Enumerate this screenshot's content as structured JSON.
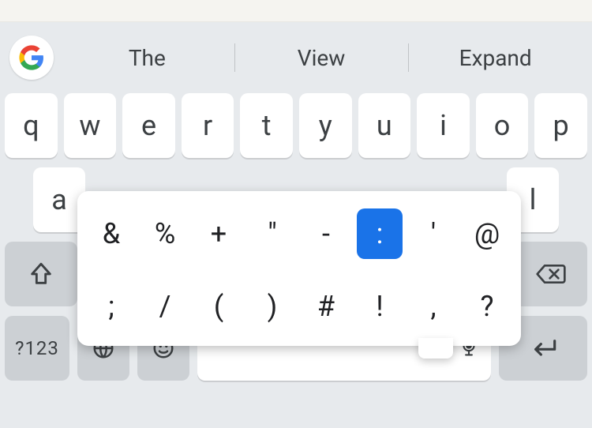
{
  "suggestions": [
    "The",
    "View",
    "Expand"
  ],
  "rows": {
    "top": [
      "q",
      "w",
      "e",
      "r",
      "t",
      "y",
      "u",
      "i",
      "o",
      "p"
    ],
    "mid_first": "a",
    "mid_last": "l",
    "numkey": "?123"
  },
  "popup": {
    "row1": [
      "&",
      "%",
      "+",
      "\"",
      "-",
      ":",
      "'",
      "@"
    ],
    "row2": [
      ";",
      "/",
      "(",
      ")",
      "#",
      "!",
      ",",
      "?"
    ],
    "selected": ":"
  },
  "icons": {
    "shift": "shift",
    "backspace": "backspace",
    "globe": "globe",
    "emoji": "emoji",
    "mic": "mic",
    "enter": "enter",
    "google": "G"
  },
  "colors": {
    "accent": "#1a73e8",
    "key_bg": "#ffffff",
    "fn_bg": "#ccd0d4",
    "kb_bg": "#e7eaed"
  }
}
